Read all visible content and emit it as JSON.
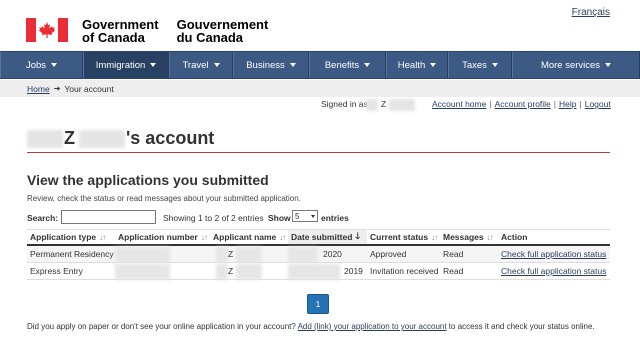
{
  "header": {
    "language_link": "Français",
    "gov_en_line1": "Government",
    "gov_en_line2": "of Canada",
    "gov_fr_line1": "Gouvernement",
    "gov_fr_line2": "du Canada"
  },
  "menu": [
    {
      "label": "Jobs"
    },
    {
      "label": "Immigration"
    },
    {
      "label": "Travel"
    },
    {
      "label": "Business"
    },
    {
      "label": "Benefits"
    },
    {
      "label": "Health"
    },
    {
      "label": "Taxes"
    },
    {
      "label": "More services"
    }
  ],
  "breadcrumb": {
    "home": "Home",
    "sep": "➜",
    "current": "Your account"
  },
  "user_bar": {
    "signed_in_as": "Signed in as",
    "name_initial": "Z",
    "account_home": "Account home",
    "account_profile": "Account profile",
    "help": "Help",
    "logout": "Logout",
    "pipe": "|"
  },
  "page": {
    "title_initial": "Z",
    "title_suffix": "'s account",
    "section_title": "View the applications you submitted",
    "section_desc": "Review, check the status or read messages about your submitted application."
  },
  "controls": {
    "search_label": "Search:",
    "showing_text": "Showing 1 to 2 of 2 entries",
    "show_label": "Show",
    "show_value": "5",
    "entries_label": "entries"
  },
  "table": {
    "headers": [
      "Application type",
      "Application number",
      "Applicant name",
      "Date submitted",
      "Current status",
      "Messages",
      "Action"
    ],
    "rows": [
      {
        "type": "Permanent Residency",
        "number": "",
        "name": "Z",
        "date": "2020",
        "status": "Approved",
        "messages": "Read",
        "action": "Check full application status"
      },
      {
        "type": "Express Entry",
        "number": "",
        "name": "Z",
        "date": "2019",
        "status": "Invitation received",
        "messages": "Read",
        "action": "Check full application status"
      }
    ]
  },
  "pagination": {
    "current": "1"
  },
  "footer": {
    "prefix": "Did you apply on paper or don't see your online application in your account?",
    "link": "Add (link) your application to your account",
    "suffix": "to access it and check your status online."
  },
  "colors": {
    "nav_bg": "#3c5a84",
    "nav_active": "#284162",
    "link": "#284162",
    "title_rule": "#af3c43",
    "page_button": "#2572b4",
    "flag_red": "#eb2d37"
  }
}
